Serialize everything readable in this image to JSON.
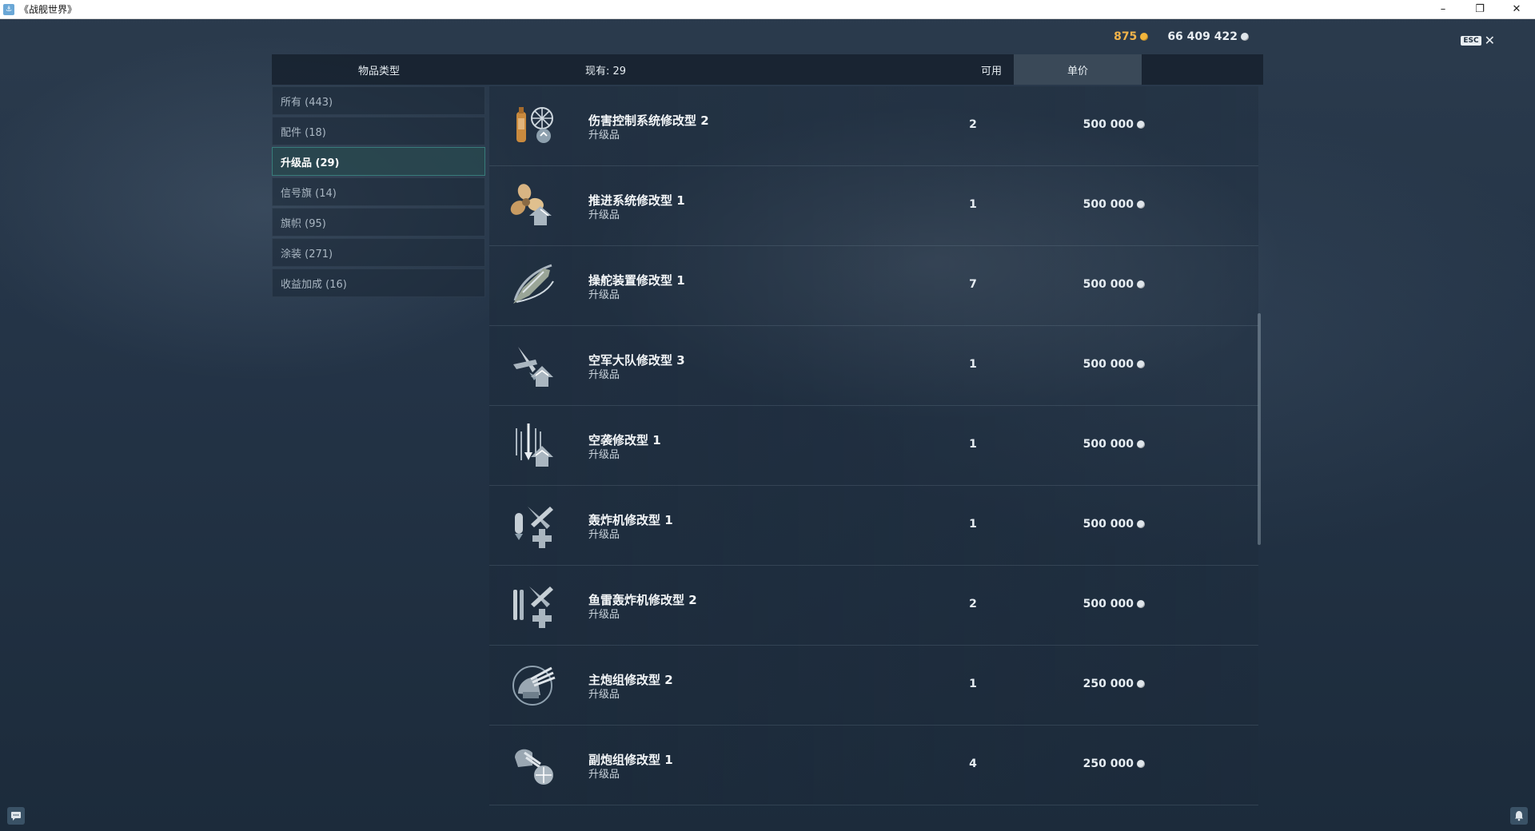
{
  "window": {
    "title": "《战舰世界》",
    "minimize": "–",
    "restore": "❐",
    "close": "✕"
  },
  "currency": {
    "gold": "875",
    "credits": "66 409 422"
  },
  "close_control": {
    "esc_label": "ESC",
    "close_symbol": "✕"
  },
  "header": {
    "type_label": "物品类型",
    "have_label": "现有: 29",
    "available_label": "可用",
    "price_label": "单价"
  },
  "categories": [
    {
      "label": "所有 (443)",
      "active": false
    },
    {
      "label": "配件 (18)",
      "active": false
    },
    {
      "label": "升级品 (29)",
      "active": true
    },
    {
      "label": "信号旗 (14)",
      "active": false
    },
    {
      "label": "旗帜 (95)",
      "active": false
    },
    {
      "label": "涂装 (271)",
      "active": false
    },
    {
      "label": "收益加成 (16)",
      "active": false
    }
  ],
  "items": [
    {
      "name": "伤害控制系统修改型 2",
      "kind": "升级品",
      "available": "2",
      "price": "500 000",
      "icon": "damage-control-icon"
    },
    {
      "name": "推进系统修改型 1",
      "kind": "升级品",
      "available": "1",
      "price": "500 000",
      "icon": "propulsion-icon"
    },
    {
      "name": "操舵装置修改型 1",
      "kind": "升级品",
      "available": "7",
      "price": "500 000",
      "icon": "steering-gear-icon"
    },
    {
      "name": "空军大队修改型 3",
      "kind": "升级品",
      "available": "1",
      "price": "500 000",
      "icon": "air-group-icon"
    },
    {
      "name": "空袭修改型 1",
      "kind": "升级品",
      "available": "1",
      "price": "500 000",
      "icon": "airstrike-icon"
    },
    {
      "name": "轰炸机修改型 1",
      "kind": "升级品",
      "available": "1",
      "price": "500 000",
      "icon": "bomber-icon"
    },
    {
      "name": "鱼雷轰炸机修改型 2",
      "kind": "升级品",
      "available": "2",
      "price": "500 000",
      "icon": "torpedo-bomber-icon"
    },
    {
      "name": "主炮组修改型 2",
      "kind": "升级品",
      "available": "1",
      "price": "250 000",
      "icon": "main-battery-icon"
    },
    {
      "name": "副炮组修改型 1",
      "kind": "升级品",
      "available": "4",
      "price": "250 000",
      "icon": "secondary-battery-icon"
    }
  ],
  "colors": {
    "gold": "#f0b34a",
    "active_border": "#46aaa0",
    "background": "#243447"
  }
}
